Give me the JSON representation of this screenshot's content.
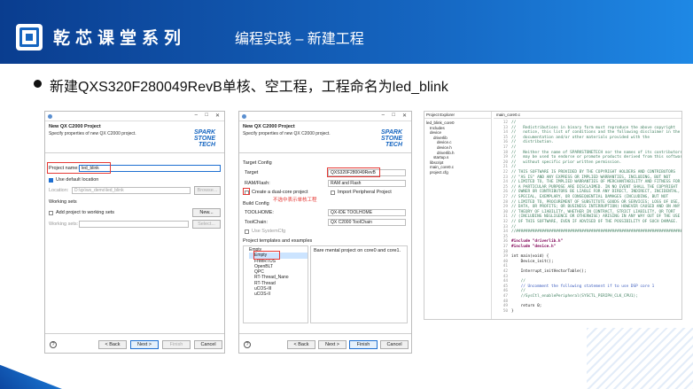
{
  "header": {
    "title": "乾芯课堂系列",
    "subtitle": "编程实践 – 新建工程"
  },
  "main": {
    "headline": "新建QXS320F280049RevB单核、空工程，工程命名为led_blink"
  },
  "dialog1": {
    "title": "New QX C2000 Project",
    "subtitle": "Specify properties of new QX C2000 project.",
    "brand": "SPARK STONE TECH",
    "project_name_label": "Project name:",
    "project_name_value": "led_blink",
    "use_default_label": "Use default location",
    "location_label": "Location:",
    "location_value": "D:\\qx\\ws_demo\\led_blink",
    "browse": "Browse...",
    "working_sets": "Working sets",
    "add_to_ws": "Add project to working sets",
    "new": "New...",
    "ws_label": "Working sets:",
    "select": "Select...",
    "back": "< Back",
    "next": "Next >",
    "finish": "Finish",
    "cancel": "Cancel"
  },
  "dialog2": {
    "title": "New QX C2000 Project",
    "subtitle": "Specify properties of new QX C2000 project.",
    "brand": "SPARK STONE TECH",
    "target_config": "Target Config",
    "target_label": "Target",
    "target_value": "QXS320F280049RevB",
    "ram_label": "RAM/Flash:",
    "ram_value": "RAM and Flash",
    "dual_core": "Create a dual-core project",
    "import_periph": "Import Peripheral Project",
    "annotation": "不选中表示单核工程",
    "build_config": "Build Config",
    "toolhome_label": "TOOLHOME:",
    "toolhome_value": "QX-IDE TOOLHOME",
    "toolchain_label": "ToolChain:",
    "toolchain_value": "QX C2000 ToolChain",
    "use_sysconfig": "Use SystemCfg",
    "templates_label": "Project templates and examples",
    "templates": [
      "Empty",
      "Empty",
      "FreeRTOS",
      "OpenBLT",
      "QPC",
      "RT-Thread_Nano",
      "RT-Thread",
      "uCOS-III",
      "uCOS-II"
    ],
    "template_desc": "Bare mental project on core0 and core1.",
    "back": "< Back",
    "next": "Next >",
    "finish": "Finish",
    "cancel": "Cancel"
  },
  "ide": {
    "explorer_title": "Project Explorer",
    "editor_tab": "main_core0.c",
    "tree": [
      "led_blink_core0",
      "Includes",
      "device",
      "driverlib",
      "device.c",
      "device.h",
      "driverlib.h",
      "startup.s",
      "libscript",
      "main_core0.c",
      "project.cfg"
    ],
    "code": [
      {
        "n": "12",
        "t": "//"
      },
      {
        "n": "13",
        "t": "//   Redistributions in binary form must reproduce the above copyright"
      },
      {
        "n": "14",
        "t": "//   notice, this list of conditions and the following disclaimer in the"
      },
      {
        "n": "15",
        "t": "//   documentation and/or other materials provided with the"
      },
      {
        "n": "16",
        "t": "//   distribution."
      },
      {
        "n": "17",
        "t": "//"
      },
      {
        "n": "18",
        "t": "//   Neither the name of SPARKSTONETECH nor the names of its contributors"
      },
      {
        "n": "19",
        "t": "//   may be used to endorse or promote products derived from this software"
      },
      {
        "n": "20",
        "t": "//   without specific prior written permission."
      },
      {
        "n": "21",
        "t": "//"
      },
      {
        "n": "22",
        "t": "// THIS SOFTWARE IS PROVIDED BY THE COPYRIGHT HOLDERS AND CONTRIBUTORS"
      },
      {
        "n": "23",
        "t": "// \"AS IS\" AND ANY EXPRESS OR IMPLIED WARRANTIES, INCLUDING, BUT NOT"
      },
      {
        "n": "24",
        "t": "// LIMITED TO, THE IMPLIED WARRANTIES OF MERCHANTABILITY AND FITNESS FOR"
      },
      {
        "n": "25",
        "t": "// A PARTICULAR PURPOSE ARE DISCLAIMED. IN NO EVENT SHALL THE COPYRIGHT"
      },
      {
        "n": "26",
        "t": "// OWNER OR CONTRIBUTORS BE LIABLE FOR ANY DIRECT, INDIRECT, INCIDENTAL,"
      },
      {
        "n": "27",
        "t": "// SPECIAL, EXEMPLARY, OR CONSEQUENTIAL DAMAGES (INCLUDING, BUT NOT"
      },
      {
        "n": "28",
        "t": "// LIMITED TO, PROCUREMENT OF SUBSTITUTE GOODS OR SERVICES; LOSS OF USE,"
      },
      {
        "n": "29",
        "t": "// DATA, OR PROFITS; OR BUSINESS INTERRUPTION) HOWEVER CAUSED AND ON ANY"
      },
      {
        "n": "30",
        "t": "// THEORY OF LIABILITY, WHETHER IN CONTRACT, STRICT LIABILITY, OR TORT"
      },
      {
        "n": "31",
        "t": "// (INCLUDING NEGLIGENCE OR OTHERWISE) ARISING IN ANY WAY OUT OF THE USE"
      },
      {
        "n": "32",
        "t": "// OF THIS SOFTWARE, EVEN IF ADVISED OF THE POSSIBILITY OF SUCH DAMAGE."
      },
      {
        "n": "33",
        "t": "//"
      },
      {
        "n": "34",
        "t": "//#############################################################################"
      },
      {
        "n": "35",
        "t": ""
      },
      {
        "n": "36",
        "t": "#include \"driverlib.h\""
      },
      {
        "n": "37",
        "t": "#include \"device.h\""
      },
      {
        "n": "38",
        "t": ""
      },
      {
        "n": "39",
        "t": "int main(void) {"
      },
      {
        "n": "40",
        "t": "    Device_init();"
      },
      {
        "n": "41",
        "t": ""
      },
      {
        "n": "42",
        "t": "    Interrupt_initVectorTable();"
      },
      {
        "n": "43",
        "t": ""
      },
      {
        "n": "44",
        "t": "    //"
      },
      {
        "n": "45",
        "t": "    // Uncomment the following statement if to use DSP core 1"
      },
      {
        "n": "46",
        "t": "    //"
      },
      {
        "n": "47",
        "t": "    //SysCtl_enablePeripheral(SYSCTL_PERIPH_CLK_CPU1);"
      },
      {
        "n": "48",
        "t": ""
      },
      {
        "n": "49",
        "t": "    return 0;"
      },
      {
        "n": "50",
        "t": "}"
      }
    ]
  }
}
